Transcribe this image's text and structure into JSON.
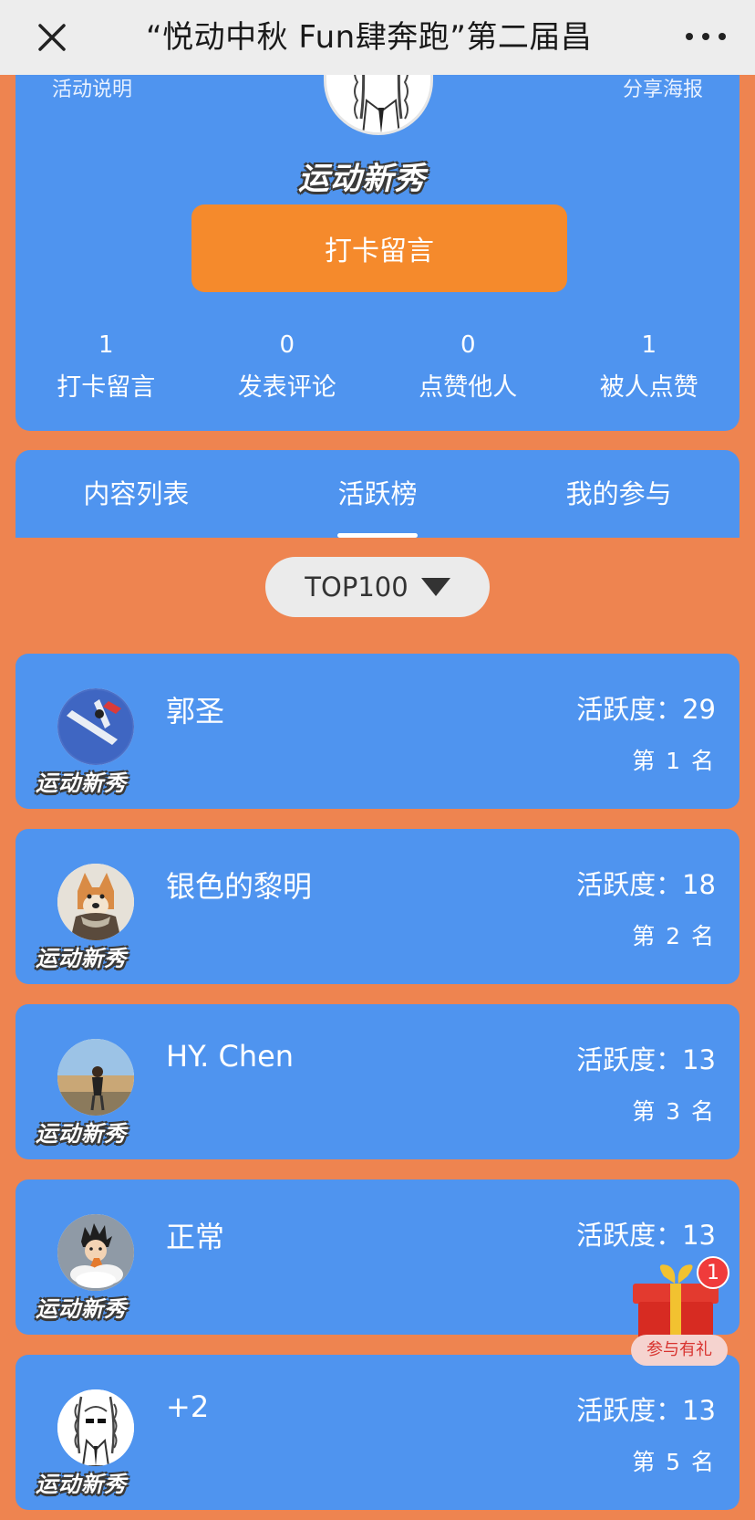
{
  "navbar": {
    "title": "“悦动中秋 Fun肆奔跑”第二届昌",
    "close_icon": "close-icon",
    "more_icon": "more-icon"
  },
  "header": {
    "left_link": "活动说明",
    "right_link": "分享海报",
    "brand": "运动新秀",
    "checkin_button": "打卡留言"
  },
  "stats": [
    {
      "value": "1",
      "label": "打卡留言"
    },
    {
      "value": "0",
      "label": "发表评论"
    },
    {
      "value": "0",
      "label": "点赞他人"
    },
    {
      "value": "1",
      "label": "被人点赞"
    }
  ],
  "tabs": [
    {
      "label": "内容列表",
      "active": false
    },
    {
      "label": "活跃榜",
      "active": true
    },
    {
      "label": "我的参与",
      "active": false
    }
  ],
  "filter": {
    "selected": "TOP100"
  },
  "ranking": [
    {
      "name": "郭圣",
      "score": "活跃度：29",
      "rank": "第 1 名",
      "brand": "运动新秀",
      "avatar": "airplane-avatar"
    },
    {
      "name": "银色的黎明",
      "score": "活跃度：18",
      "rank": "第 2 名",
      "brand": "运动新秀",
      "avatar": "dog-avatar"
    },
    {
      "name": "HY. Chen",
      "score": "活跃度：13",
      "rank": "第 3 名",
      "brand": "运动新秀",
      "avatar": "photo-avatar"
    },
    {
      "name": "正常",
      "score": "活跃度：13",
      "rank": "",
      "brand": "运动新秀",
      "avatar": "cartoon-avatar"
    },
    {
      "name": "+2",
      "score": "活跃度：13",
      "rank": "第 5 名",
      "brand": "运动新秀",
      "avatar": "sketch-avatar"
    }
  ],
  "gift": {
    "badge": "1",
    "label": "参与有礼"
  },
  "colors": {
    "background": "#ee8450",
    "card": "#4f94ef",
    "button": "#f58a2c"
  }
}
